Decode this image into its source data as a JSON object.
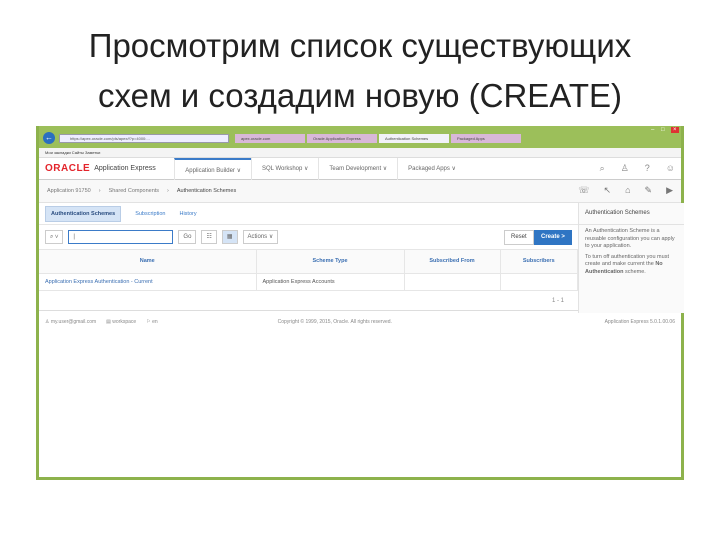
{
  "slide": {
    "title_line1": "Просмотрим список существующих",
    "title_line2": "схем и создадим новую (CREATE)"
  },
  "browser": {
    "url": "https://apex.oracle.com/pls/apex/f?p=4000:...",
    "tabs": [
      "apex.oracle.com",
      "Oracle Application Express",
      "Authentication Schemes",
      "Packaged Apps"
    ],
    "bookmarks": "Мои закладки   Сайты   Заметки"
  },
  "header": {
    "logo": "ORACLE",
    "product": "Application Express",
    "nav": [
      "Application Builder ∨",
      "SQL Workshop ∨",
      "Team Development ∨",
      "Packaged Apps ∨"
    ]
  },
  "breadcrumb": {
    "items": [
      "Application 91750",
      "Shared Components",
      "Authentication Schemes"
    ]
  },
  "subtabs": [
    "Authentication Schemes",
    "Subscription",
    "History"
  ],
  "toolbar": {
    "search_icon": "search-icon",
    "go": "Go",
    "actions": "Actions ∨",
    "reset": "Reset",
    "create": "Create >"
  },
  "table": {
    "headers": [
      "Name",
      "Scheme Type",
      "Subscribed From",
      "Subscribers"
    ],
    "rows": [
      [
        "Application Express Authentication - Current",
        "Application Express Accounts",
        "",
        ""
      ]
    ],
    "pagination": "1 - 1"
  },
  "side": {
    "title": "Authentication Schemes",
    "p1": "An Authentication Scheme is a reusable configuration you can apply to your application.",
    "p2": "To turn off authentication you must create and make current the",
    "p2_bold": "No Authentication",
    "p2_end": "scheme."
  },
  "footer": {
    "user": "my.user@gmail.com",
    "workspace": "workspace",
    "lang": "en",
    "copyright": "Copyright © 1999, 2015, Oracle. All rights reserved.",
    "version": "Application Express 5.0.1.00.06"
  }
}
